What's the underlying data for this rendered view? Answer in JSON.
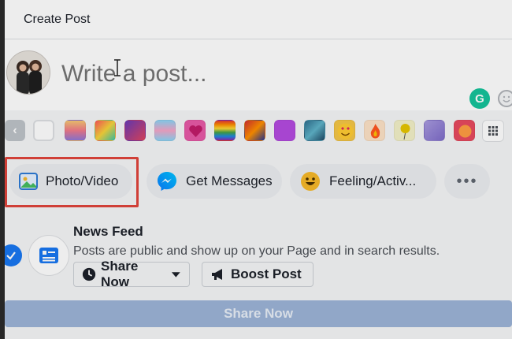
{
  "header": {
    "title": "Create Post"
  },
  "composer": {
    "placeholder": "Write a post..."
  },
  "tools": {
    "grammarly_letter": "G"
  },
  "actions": {
    "photo_video": "Photo/Video",
    "get_messages": "Get Messages",
    "feeling": "Feeling/Activ...",
    "more": "•••"
  },
  "feed": {
    "title": "News Feed",
    "description": "Posts are public and show up on your Page and in search results.",
    "share_now_dropdown": "Share Now",
    "boost_post": "Boost Post"
  },
  "share_button": "Share Now",
  "colors": {
    "accent": "#1877f2",
    "highlight": "#e0443c",
    "grammarly": "#15c39a",
    "share_disabled": "#9cb4d8"
  },
  "backgrounds": [
    "plain-white",
    "rainbow-gradient",
    "yellow-orange-gradient",
    "purple-red-gradient",
    "pastel-pink-blue",
    "pink-heart",
    "pride-flag",
    "red-blue-stripes",
    "solid-purple",
    "blue-teal-art",
    "heart-eyes-emoji",
    "fire-emoji",
    "yellow-balloon",
    "lavender-cube",
    "red-orange-circle"
  ]
}
